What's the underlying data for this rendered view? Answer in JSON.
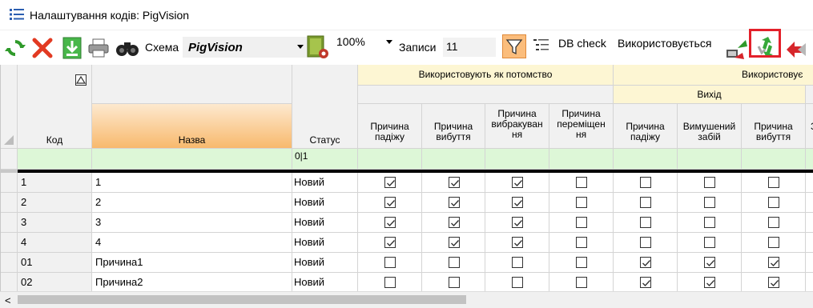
{
  "window": {
    "title": "Налаштування кодів: PigVision"
  },
  "toolbar": {
    "scheme_label": "Схема",
    "scheme_value": "PigVision",
    "zoom_value": "100%",
    "records_label": "Записи",
    "records_value": "11",
    "db_check_label": "DB check",
    "used_label": "Використовується"
  },
  "grid": {
    "group_header_1": "Використовують як потомство",
    "group_header_2": "Використовує",
    "subgroup_exit": "Вихід",
    "col_code": "Код",
    "col_name": "Назва",
    "col_status": "Статус",
    "status_filter": "0|1",
    "offspring_cols": [
      "Причина\nпадіжу",
      "Причина\nвибуття",
      "Причина\nвибракуван\nня",
      "Причина\nпереміщен\nня"
    ],
    "used_cols": [
      "Причина\nпадіжу",
      "Вимушений\nзабій",
      "Причина\nвибуття"
    ],
    "rows": [
      {
        "code": "1",
        "name": "1",
        "status": "Новий",
        "checks": [
          true,
          true,
          true,
          false,
          false,
          false,
          false
        ]
      },
      {
        "code": "2",
        "name": "2",
        "status": "Новий",
        "checks": [
          true,
          true,
          true,
          false,
          false,
          false,
          false
        ]
      },
      {
        "code": "3",
        "name": "3",
        "status": "Новий",
        "checks": [
          true,
          true,
          true,
          false,
          false,
          false,
          false
        ]
      },
      {
        "code": "4",
        "name": "4",
        "status": "Новий",
        "checks": [
          true,
          true,
          true,
          false,
          false,
          false,
          false
        ]
      },
      {
        "code": "01",
        "name": "Причина1",
        "status": "Новий",
        "checks": [
          false,
          false,
          false,
          false,
          true,
          true,
          true
        ]
      },
      {
        "code": "02",
        "name": "Причина2",
        "status": "Новий",
        "checks": [
          false,
          false,
          false,
          false,
          true,
          true,
          true
        ]
      }
    ]
  },
  "icons": [
    "list-icon",
    "refresh-icon",
    "delete-icon",
    "import-icon",
    "print-icon",
    "binoculars-icon",
    "scheme-settings-icon",
    "filter-icon",
    "columns-icon",
    "move-icon",
    "transfer-icon",
    "back-icon"
  ],
  "colors": {
    "filter_active": "#fbbd7c",
    "highlight": "#e3202a",
    "filter_row": "#ddf7d7",
    "group_header": "#fdf6d3"
  }
}
